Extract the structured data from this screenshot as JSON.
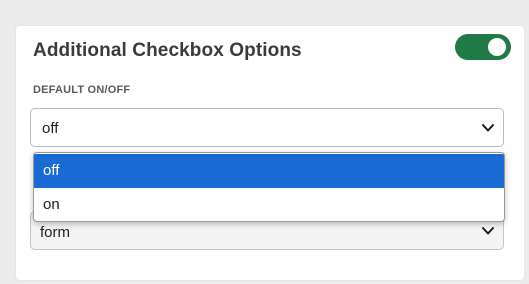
{
  "section": {
    "title": "Additional Checkbox Options",
    "toggle_on": true
  },
  "default_field": {
    "label": "DEFAULT ON/OFF",
    "value": "off",
    "options": [
      "off",
      "on"
    ],
    "highlighted_option": "off"
  },
  "second_field": {
    "value": "form"
  },
  "colors": {
    "toggle_on": "#1f7a46",
    "highlight": "#1a6ad6"
  }
}
